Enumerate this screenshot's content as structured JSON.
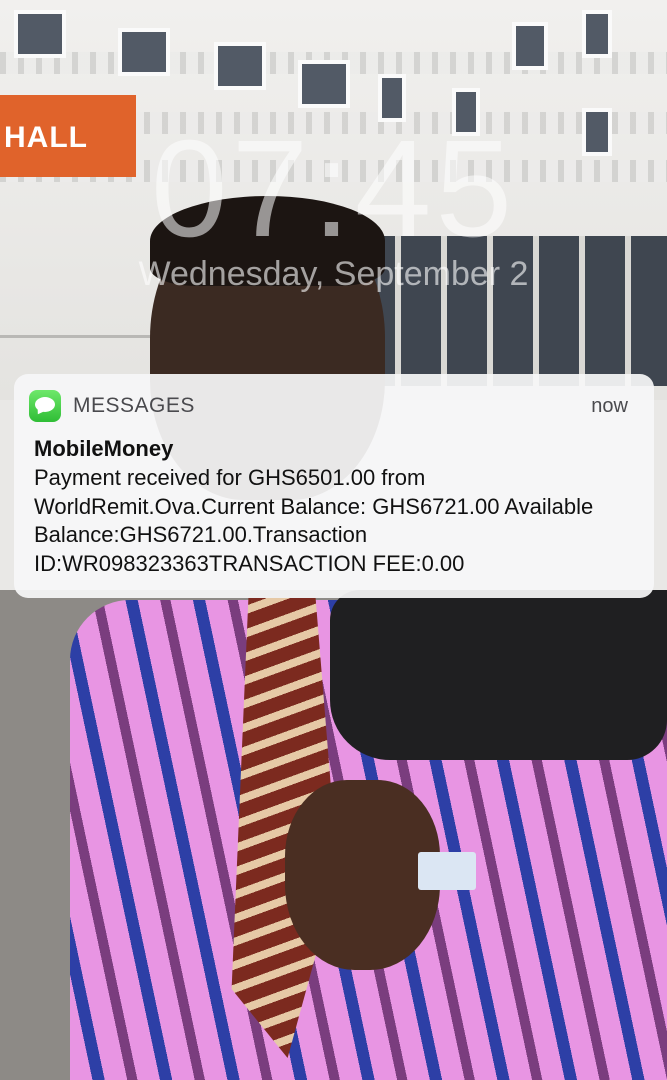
{
  "lockscreen": {
    "time": "07:45",
    "date": "Wednesday, September 2"
  },
  "wallpaper": {
    "sign_text": "HALL"
  },
  "notification": {
    "app_icon": "messages-icon",
    "app_name": "MESSAGES",
    "timestamp": "now",
    "sender": "MobileMoney",
    "message": "Payment received for GHS6501.00 from WorldRemit.Ova.Current Balance: GHS6721.00 Available Balance:GHS6721.00.Transaction ID:WR098323363TRANSACTION FEE:0.00"
  },
  "colors": {
    "messages_green": "#34c759"
  }
}
